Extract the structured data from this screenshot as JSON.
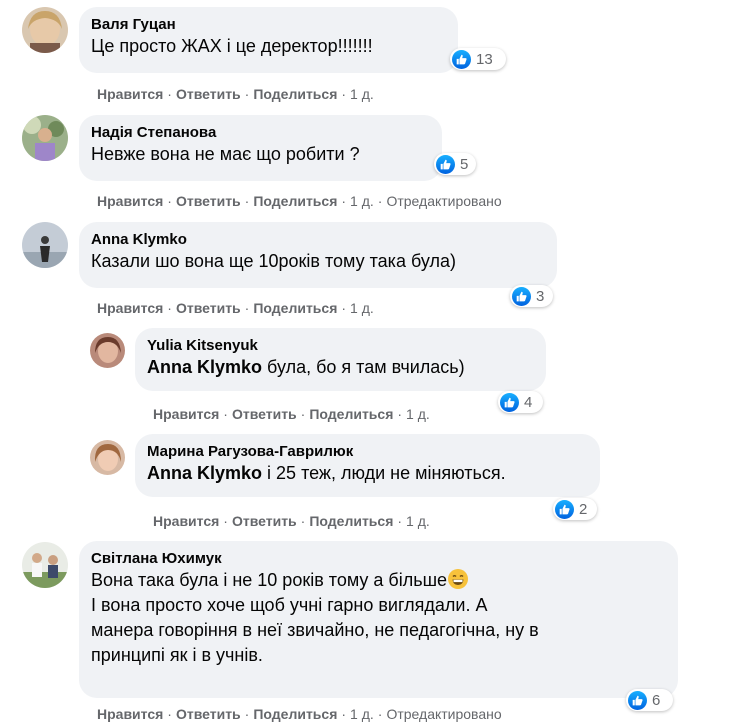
{
  "comments": [
    {
      "author": "Валя Гуцан",
      "text": "Це просто ЖАХ і це деректор!!!!!!!",
      "reactions": "13",
      "like": "Нравится",
      "reply": "Ответить",
      "share": "Поделиться",
      "time": "1 д."
    },
    {
      "author": "Надія Степанова",
      "text": "Невже вона не має що робити ?",
      "reactions": "5",
      "like": "Нравится",
      "reply": "Ответить",
      "share": "Поделиться",
      "time": "1 д.",
      "edited": "Отредактировано"
    },
    {
      "author": "Anna Klymko",
      "text": "Казали шо вона ще 10років тому така була)",
      "reactions": "3",
      "like": "Нравится",
      "reply": "Ответить",
      "share": "Поделиться",
      "time": "1 д."
    },
    {
      "author": "Yulia Kitsenyuk",
      "mention": "Anna Klymko",
      "text": "була, бо я там вчилась)",
      "reactions": "4",
      "like": "Нравится",
      "reply": "Ответить",
      "share": "Поделиться",
      "time": "1 д."
    },
    {
      "author": "Марина Рагузова-Гаврилюк",
      "mention": "Anna Klymko",
      "text": "і 25 теж, люди не міняються.",
      "reactions": "2",
      "like": "Нравится",
      "reply": "Ответить",
      "share": "Поделиться",
      "time": "1 д."
    },
    {
      "author": "Світлана Юхимук",
      "lines": [
        "Вона така була і не 10 років тому а більше",
        "І вона просто хоче щоб учні гарно виглядали. А",
        "манера говоріння в неї звичайно, не педагогічна, ну в",
        "принципі як і в учнів."
      ],
      "reactions": "6",
      "like": "Нравится",
      "reply": "Ответить",
      "share": "Поделиться",
      "time": "1 д.",
      "edited": "Отредактировано"
    }
  ],
  "colors": {
    "bubble": "#f0f2f5",
    "meta_text": "#65676b",
    "like_blue": "#1877f2"
  },
  "icons": {
    "reaction": "like-icon",
    "emoji": "grinning-face-emoji"
  }
}
